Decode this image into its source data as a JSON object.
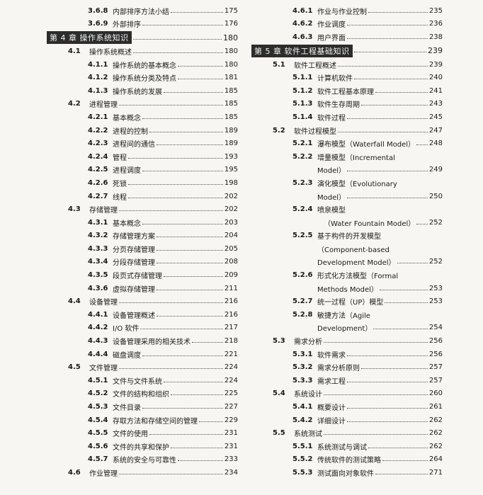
{
  "left_column": [
    {
      "level": 3,
      "number": "3.6.8",
      "title": "内部排序方法小结",
      "page": "175"
    },
    {
      "level": 3,
      "number": "3.6.9",
      "title": "外部排序",
      "page": "176"
    },
    {
      "level": 1,
      "number": "第 4 章",
      "title": "操作系统知识",
      "page": "180"
    },
    {
      "level": 2,
      "number": "4.1",
      "title": "操作系统概述",
      "page": "180"
    },
    {
      "level": 3,
      "number": "4.1.1",
      "title": "操作系统的基本概念",
      "page": "180"
    },
    {
      "level": 3,
      "number": "4.1.2",
      "title": "操作系统分类及特点",
      "page": "181"
    },
    {
      "level": 3,
      "number": "4.1.3",
      "title": "操作系统的发展",
      "page": "185"
    },
    {
      "level": 2,
      "number": "4.2",
      "title": "进程管理",
      "page": "185"
    },
    {
      "level": 3,
      "number": "4.2.1",
      "title": "基本概念",
      "page": "185"
    },
    {
      "level": 3,
      "number": "4.2.2",
      "title": "进程的控制",
      "page": "189"
    },
    {
      "level": 3,
      "number": "4.2.3",
      "title": "进程间的通信",
      "page": "189"
    },
    {
      "level": 3,
      "number": "4.2.4",
      "title": "管程",
      "page": "193"
    },
    {
      "level": 3,
      "number": "4.2.5",
      "title": "进程调度",
      "page": "195"
    },
    {
      "level": 3,
      "number": "4.2.6",
      "title": "死锁",
      "page": "198"
    },
    {
      "level": 3,
      "number": "4.2.7",
      "title": "线程",
      "page": "202"
    },
    {
      "level": 2,
      "number": "4.3",
      "title": "存储管理",
      "page": "202"
    },
    {
      "level": 3,
      "number": "4.3.1",
      "title": "基本概念",
      "page": "203"
    },
    {
      "level": 3,
      "number": "4.3.2",
      "title": "存储管理方案",
      "page": "204"
    },
    {
      "level": 3,
      "number": "4.3.3",
      "title": "分页存储管理",
      "page": "205"
    },
    {
      "level": 3,
      "number": "4.3.4",
      "title": "分段存储管理",
      "page": "208"
    },
    {
      "level": 3,
      "number": "4.3.5",
      "title": "段页式存储管理",
      "page": "209"
    },
    {
      "level": 3,
      "number": "4.3.6",
      "title": "虚拟存储管理",
      "page": "211"
    },
    {
      "level": 2,
      "number": "4.4",
      "title": "设备管理",
      "page": "216"
    },
    {
      "level": 3,
      "number": "4.4.1",
      "title": "设备管理概述",
      "page": "216"
    },
    {
      "level": 3,
      "number": "4.4.2",
      "title": "I/O 软件",
      "page": "217"
    },
    {
      "level": 3,
      "number": "4.4.3",
      "title": "设备管理采用的相关技术",
      "page": "218"
    },
    {
      "level": 3,
      "number": "4.4.4",
      "title": "磁盘调度",
      "page": "221"
    },
    {
      "level": 2,
      "number": "4.5",
      "title": "文件管理",
      "page": "224"
    },
    {
      "level": 3,
      "number": "4.5.1",
      "title": "文件与文件系统",
      "page": "224"
    },
    {
      "level": 3,
      "number": "4.5.2",
      "title": "文件的结构和组织",
      "page": "225"
    },
    {
      "level": 3,
      "number": "4.5.3",
      "title": "文件目录",
      "page": "227"
    },
    {
      "level": 3,
      "number": "4.5.4",
      "title": "存取方法和存储空间的管理",
      "page": "229"
    },
    {
      "level": 3,
      "number": "4.5.5",
      "title": "文件的使用",
      "page": "231"
    },
    {
      "level": 3,
      "number": "4.5.6",
      "title": "文件的共享和保护",
      "page": "231"
    },
    {
      "level": 3,
      "number": "4.5.7",
      "title": "系统的安全与可靠性",
      "page": "233"
    },
    {
      "level": 2,
      "number": "4.6",
      "title": "作业管理",
      "page": "234"
    }
  ],
  "right_column": [
    {
      "level": 3,
      "number": "4.6.1",
      "title": "作业与作业控制",
      "page": "235"
    },
    {
      "level": 3,
      "number": "4.6.2",
      "title": "作业调度",
      "page": "236"
    },
    {
      "level": 3,
      "number": "4.6.3",
      "title": "用户界面",
      "page": "238"
    },
    {
      "level": 1,
      "number": "第 5 章",
      "title": "软件工程基础知识",
      "page": "239"
    },
    {
      "level": 2,
      "number": "5.1",
      "title": "软件工程概述",
      "page": "239"
    },
    {
      "level": 3,
      "number": "5.1.1",
      "title": "计算机软件",
      "page": "240"
    },
    {
      "level": 3,
      "number": "5.1.2",
      "title": "软件工程基本原理",
      "page": "241"
    },
    {
      "level": 3,
      "number": "5.1.3",
      "title": "软件生存周期",
      "page": "243"
    },
    {
      "level": 3,
      "number": "5.1.4",
      "title": "软件过程",
      "page": "245"
    },
    {
      "level": 2,
      "number": "5.2",
      "title": "软件过程模型",
      "page": "247"
    },
    {
      "level": 3,
      "number": "5.2.1",
      "title": "瀑布模型（Waterfall Model）",
      "page": "248"
    },
    {
      "level": 3,
      "number": "5.2.2",
      "title": "增量模型（Incremental",
      "page": ""
    },
    {
      "level": 4,
      "number": "",
      "title": "Model）",
      "page": "249"
    },
    {
      "level": 3,
      "number": "5.2.3",
      "title": "演化模型（Evolutionary",
      "page": ""
    },
    {
      "level": 4,
      "number": "",
      "title": "Model）",
      "page": "250"
    },
    {
      "level": 3,
      "number": "5.2.4",
      "title": "喷泉模型",
      "page": ""
    },
    {
      "level": 5,
      "number": "",
      "title": "（Water Fountain Model）",
      "page": "252"
    },
    {
      "level": 3,
      "number": "5.2.5",
      "title": "基于构件的开发模型",
      "page": ""
    },
    {
      "level": 4,
      "number": "",
      "title": "（Component-based",
      "page": ""
    },
    {
      "level": 4,
      "number": "",
      "title": "Development Model）",
      "page": "252"
    },
    {
      "level": 3,
      "number": "5.2.6",
      "title": "形式化方法模型（Formal",
      "page": ""
    },
    {
      "level": 4,
      "number": "",
      "title": "Methods Model）",
      "page": "253"
    },
    {
      "level": 3,
      "number": "5.2.7",
      "title": "统一过程（UP）模型",
      "page": "253"
    },
    {
      "level": 3,
      "number": "5.2.8",
      "title": "敏捷方法（Agile",
      "page": ""
    },
    {
      "level": 4,
      "number": "",
      "title": "Development）",
      "page": "254"
    },
    {
      "level": 2,
      "number": "5.3",
      "title": "需求分析",
      "page": "256"
    },
    {
      "level": 3,
      "number": "5.3.1",
      "title": "软件需求",
      "page": "256"
    },
    {
      "level": 3,
      "number": "5.3.2",
      "title": "需求分析原则",
      "page": "257"
    },
    {
      "level": 3,
      "number": "5.3.3",
      "title": "需求工程",
      "page": "257"
    },
    {
      "level": 2,
      "number": "5.4",
      "title": "系统设计",
      "page": "260"
    },
    {
      "level": 3,
      "number": "5.4.1",
      "title": "概要设计",
      "page": "261"
    },
    {
      "level": 3,
      "number": "5.4.2",
      "title": "详细设计",
      "page": "262"
    },
    {
      "level": 2,
      "number": "5.5",
      "title": "系统测试",
      "page": "262"
    },
    {
      "level": 3,
      "number": "5.5.1",
      "title": "系统测试与调试",
      "page": "262"
    },
    {
      "level": 3,
      "number": "5.5.2",
      "title": "传统软件的测试策略",
      "page": "264"
    },
    {
      "level": 3,
      "number": "5.5.3",
      "title": "测试面向对象软件",
      "page": "271"
    }
  ]
}
